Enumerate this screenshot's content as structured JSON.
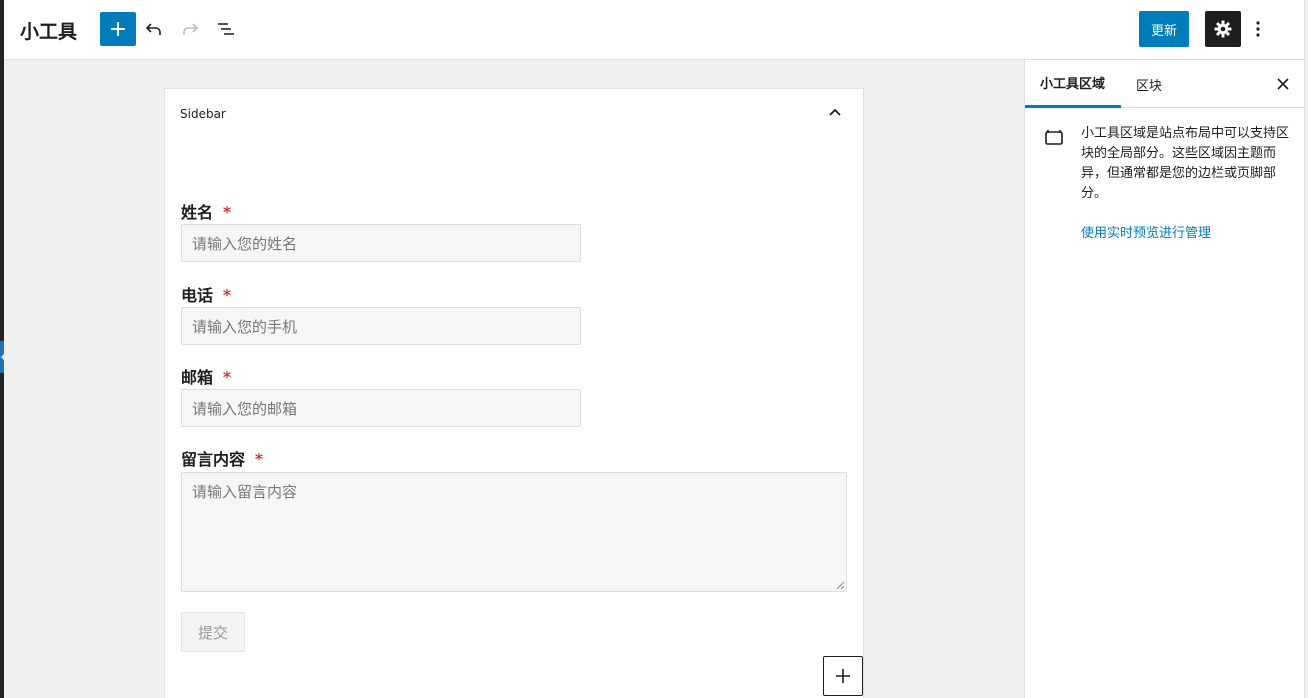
{
  "header": {
    "title": "小工具",
    "update_label": "更新"
  },
  "widget": {
    "area_title": "Sidebar",
    "form": {
      "fields": [
        {
          "label": "姓名",
          "required_mark": "*",
          "placeholder": "请输入您的姓名"
        },
        {
          "label": "电话",
          "required_mark": "*",
          "placeholder": "请输入您的手机"
        },
        {
          "label": "邮箱",
          "required_mark": "*",
          "placeholder": "请输入您的邮箱"
        },
        {
          "label": "留言内容",
          "required_mark": "*",
          "placeholder": "请输入留言内容"
        }
      ],
      "submit_label": "提交"
    }
  },
  "sidebar": {
    "tabs": [
      {
        "label": "小工具区域",
        "active": true
      },
      {
        "label": "区块",
        "active": false
      }
    ],
    "description": "小工具区域是站点布局中可以支持区块的全局部分。这些区域因主题而异，但通常都是您的边栏或页脚部分。",
    "link_label": "使用实时预览进行管理"
  },
  "colors": {
    "accent": "#007cba",
    "required": "#cc0000"
  },
  "icons": {
    "add": "plus-icon",
    "undo": "undo-icon",
    "redo": "redo-icon",
    "list_view": "list-view-icon",
    "settings": "gear-icon",
    "more": "more-vertical-icon",
    "collapse": "chevron-up-icon",
    "close": "close-icon",
    "widget_area": "widget-area-icon"
  }
}
